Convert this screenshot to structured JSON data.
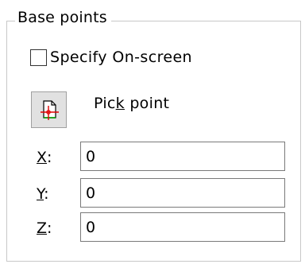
{
  "group": {
    "title": "Base points"
  },
  "specify_onscreen": {
    "label": "Specify On-screen",
    "checked": false
  },
  "pick_point": {
    "label_before": "Pic",
    "label_mnemonic": "k",
    "label_after": " point",
    "icon": "pick-point-icon"
  },
  "coords": [
    {
      "mnemonic": "X",
      "suffix": ":",
      "value": "0"
    },
    {
      "mnemonic": "Y",
      "suffix": ":",
      "value": "0"
    },
    {
      "mnemonic": "Z",
      "suffix": ":",
      "value": "0"
    }
  ],
  "colors": {
    "icon_outline": "#000000",
    "icon_crosshair_red": "#e00000",
    "icon_page_green": "#00a000",
    "button_face": "#e1e1e1"
  }
}
